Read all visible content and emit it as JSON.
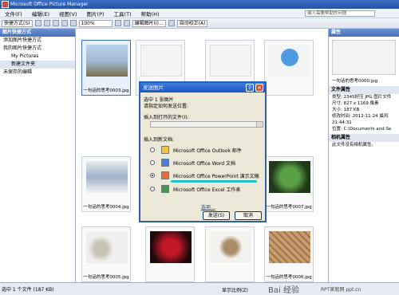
{
  "window": {
    "title": "Microsoft Office Picture Manager"
  },
  "menu": {
    "items": [
      "文件(F)",
      "编辑(E)",
      "视图(V)",
      "图片(P)",
      "工具(T)",
      "帮助(H)"
    ],
    "help_box": "键入需要帮助的问题"
  },
  "toolbar": {
    "shortcut": "快捷方式(S)",
    "zoom": "100%",
    "edit_pictures": "编辑图片(I)...",
    "auto_correct": "自动校正(A)"
  },
  "left": {
    "header": "图片快捷方式",
    "add_shortcut": "添加图片快捷方式",
    "my_shortcuts": "我的图片快捷方式",
    "my_pictures": "My Pictures",
    "new_folder": "新建文件夹",
    "unsaved": "未保存的编辑"
  },
  "thumbs": [
    "一句话的思考0003.jpg",
    "一句话的思考0004.jpg",
    "一句话的思考0005.jpg",
    "一句话的思考0006.jpg",
    "一句话的思考0007.jpg"
  ],
  "right": {
    "header": "属性",
    "file_name": "一句话的思考0000.jpg",
    "file_section": "文件属性",
    "props": [
      "类型:  2345好压 JPG 图片文件",
      "尺寸:  827 x 1169 像素",
      "大小:  187 KB",
      "修改时间: 2012-11-24 晨风",
      "21:44:31",
      "位置:  C:\\Documents and Se"
    ],
    "camera_section": "相机属性",
    "camera_text": "此文件没有相机属性。"
  },
  "status": {
    "text": "选中 1 个文件 (187 KB)",
    "zoom_label": "显示比例(Z)",
    "brand": "Bai 经验",
    "brand2": "RPT家庭网 ppt.cn"
  },
  "dialog": {
    "title": "发送图片",
    "selected": "选中 1 张图片",
    "instruction": "请指定如何发送位置:",
    "open_file_label": "插入到打开的文件(I):",
    "new_doc_label": "插入到新文档:",
    "options": [
      "Microsoft Office Outlook 邮件",
      "Microsoft Office Word 文档",
      "Microsoft Office PowerPoint 演示文稿",
      "Microsoft Office Excel 工作表"
    ],
    "options_link": "选项...",
    "send_button": "发送(S)",
    "cancel_button": "取消"
  },
  "colors": {
    "accent": "#3a6fc4",
    "dialog_title": "#1d54c2",
    "highlight": "#22c2c6"
  }
}
